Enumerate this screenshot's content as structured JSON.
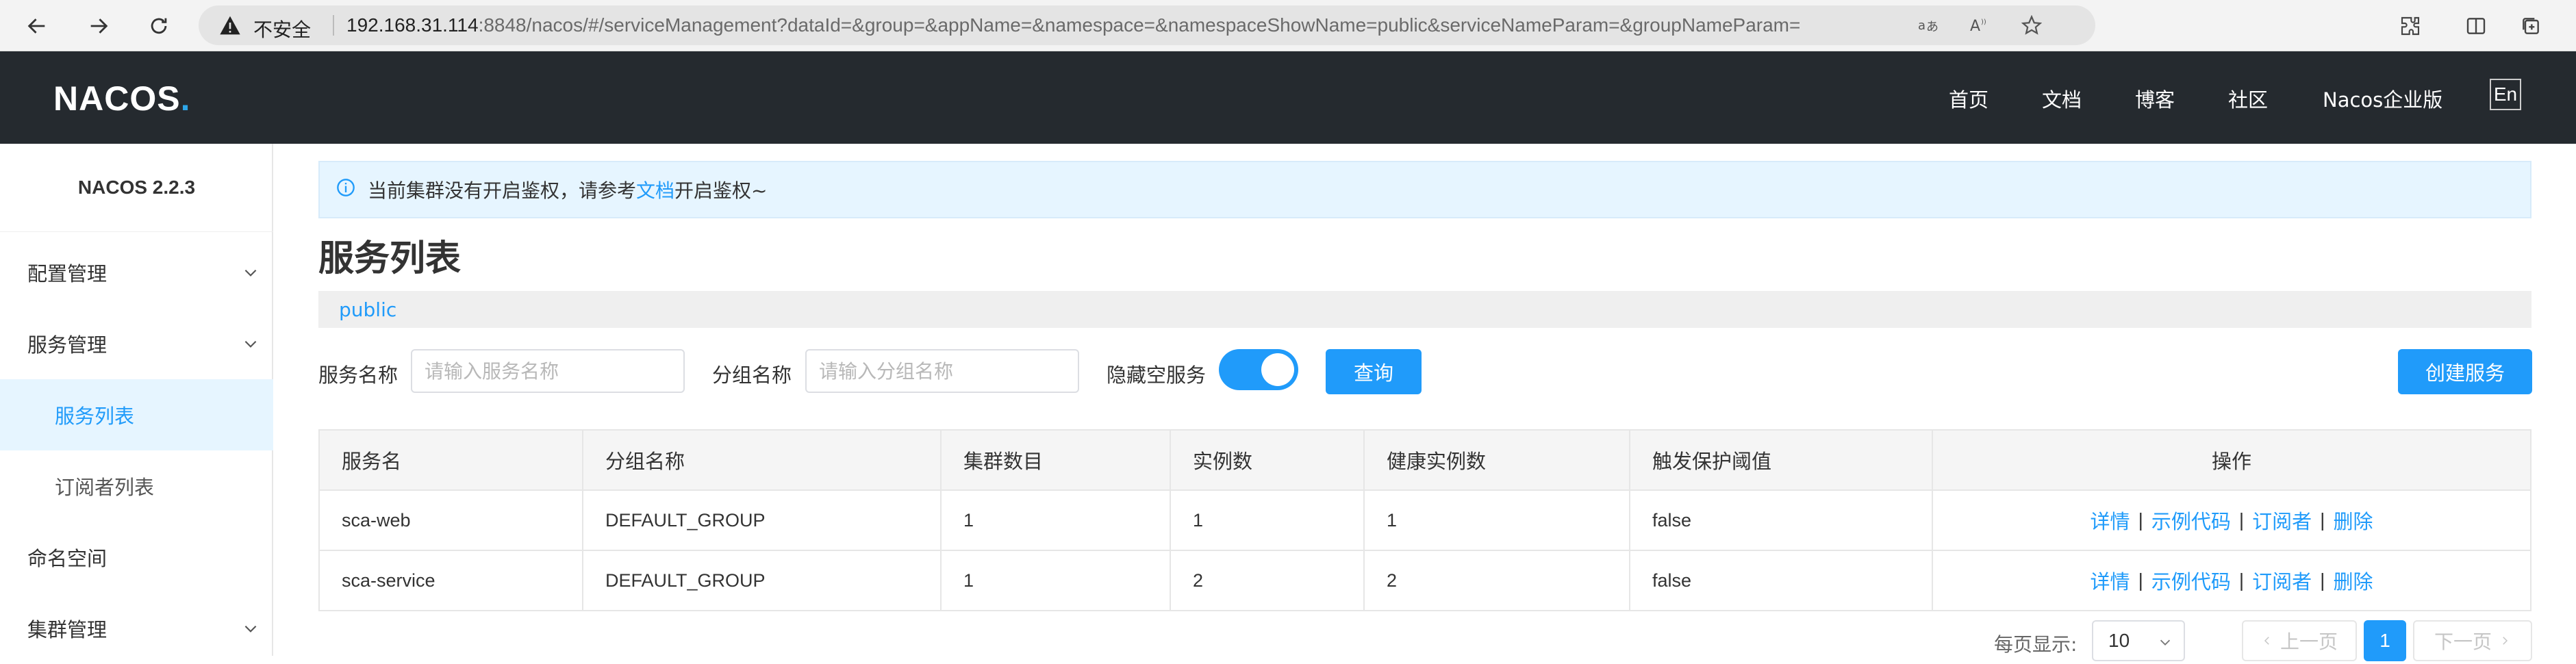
{
  "browser": {
    "security_label": "不安全",
    "url_host": "192.168.31.114",
    "url_rest": ":8848/nacos/#/serviceManagement?dataId=&group=&appName=&namespace=&namespaceShowName=public&serviceNameParam=&groupNameParam="
  },
  "header": {
    "logo": "NACOS",
    "logo_dot": ".",
    "menu": [
      "首页",
      "文档",
      "博客",
      "社区",
      "Nacos企业版"
    ],
    "lang": "En"
  },
  "sidebar": {
    "version": "NACOS 2.2.3",
    "items": [
      {
        "label": "配置管理"
      },
      {
        "label": "服务管理"
      },
      {
        "label": "服务列表"
      },
      {
        "label": "订阅者列表"
      },
      {
        "label": "命名空间"
      },
      {
        "label": "集群管理"
      }
    ]
  },
  "notice": {
    "text_before": "当前集群没有开启鉴权，请参考",
    "link": "文档",
    "text_after": "开启鉴权~"
  },
  "page": {
    "title": "服务列表",
    "namespace": "public"
  },
  "filters": {
    "service_name_label": "服务名称",
    "service_name_placeholder": "请输入服务名称",
    "group_name_label": "分组名称",
    "group_name_placeholder": "请输入分组名称",
    "hide_empty_label": "隐藏空服务",
    "hide_empty_enabled": true,
    "query_button": "查询",
    "create_button": "创建服务"
  },
  "table": {
    "headers": [
      "服务名",
      "分组名称",
      "集群数目",
      "实例数",
      "健康实例数",
      "触发保护阈值",
      "操作"
    ],
    "rows": [
      {
        "service": "sca-web",
        "group": "DEFAULT_GROUP",
        "clusters": "1",
        "instances": "1",
        "healthy": "1",
        "threshold": "false"
      },
      {
        "service": "sca-service",
        "group": "DEFAULT_GROUP",
        "clusters": "1",
        "instances": "2",
        "healthy": "2",
        "threshold": "false"
      }
    ],
    "operations": [
      "详情",
      "示例代码",
      "订阅者",
      "删除"
    ],
    "op_separator": "|"
  },
  "pagination": {
    "per_page_label": "每页显示:",
    "per_page_value": "10",
    "prev": "上一页",
    "current_page": "1",
    "next": "下一页"
  },
  "colors": {
    "accent": "#209bfa",
    "header_bg": "#252a2f"
  }
}
